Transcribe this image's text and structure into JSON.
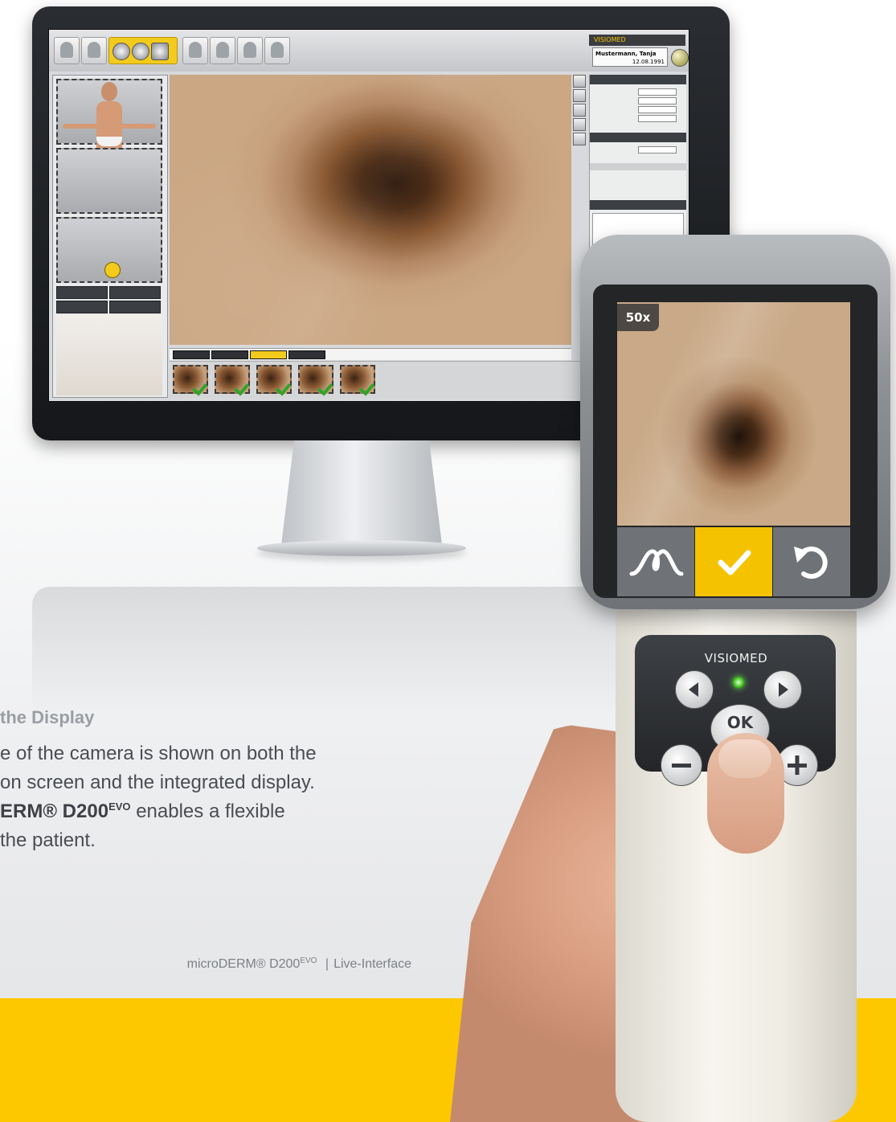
{
  "software": {
    "brand": "VISIOMED",
    "patient_name": "Mustermann, Tanja",
    "patient_dob": "12.08.1991"
  },
  "device": {
    "zoom": "50x",
    "brand": "VISIOMED",
    "keys": {
      "ok": "OK"
    }
  },
  "caption": {
    "title": "the Display",
    "line1": "e of the camera is shown on both the",
    "line2": "on screen and the integrated display.",
    "line3_bold": "ERM® D200",
    "line3_sup": "EVO",
    "line3_rest": " enables a flexible",
    "line4": "the patient."
  },
  "footer": {
    "product": "microDERM® D200",
    "product_sup": "EVO",
    "separator": "|",
    "section": "Live-Interface"
  },
  "colors": {
    "accent": "#fdc800",
    "confirm_button": "#f5c200",
    "check_green": "#2fa42a",
    "led_green": "#3fc21b"
  },
  "icons": [
    "analysis-curve-icon",
    "checkmark-icon",
    "undo-icon",
    "arrow-left-icon",
    "arrow-right-icon",
    "minus-icon",
    "plus-icon",
    "globe-icon"
  ]
}
